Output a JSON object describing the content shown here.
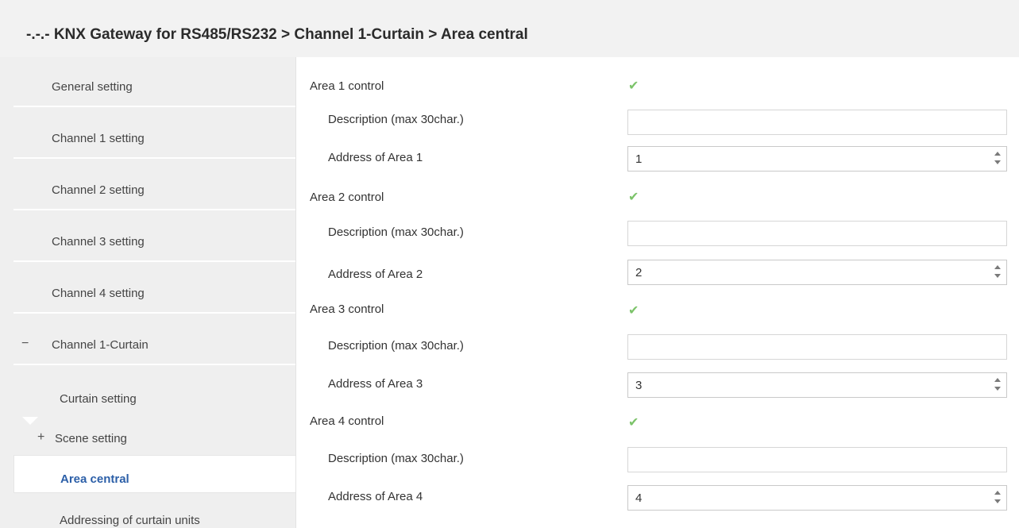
{
  "header": {
    "title": "-.-.- KNX Gateway for RS485/RS232 > Channel 1-Curtain > Area central"
  },
  "sidebar": {
    "items": [
      {
        "label": "General setting"
      },
      {
        "label": "Channel 1 setting"
      },
      {
        "label": "Channel 2 setting"
      },
      {
        "label": "Channel 3 setting"
      },
      {
        "label": "Channel 4 setting"
      },
      {
        "label": "Channel 1-Curtain",
        "sign": "−"
      },
      {
        "label": "Curtain setting"
      },
      {
        "label": "Scene setting",
        "sign": "+"
      },
      {
        "label": "Area central",
        "active": true
      },
      {
        "label": "Addressing of curtain units"
      }
    ]
  },
  "main": {
    "areas": [
      {
        "control_label": "Area 1 control",
        "description_label": "Description (max 30char.)",
        "description_value": "",
        "address_label": "Address of Area 1",
        "address_value": "1",
        "checked": true
      },
      {
        "control_label": "Area 2 control",
        "description_label": "Description (max 30char.)",
        "description_value": "",
        "address_label": "Address of Area 2",
        "address_value": "2",
        "checked": true
      },
      {
        "control_label": "Area 3 control",
        "description_label": "Description (max 30char.)",
        "description_value": "",
        "address_label": "Address of Area 3",
        "address_value": "3",
        "checked": true
      },
      {
        "control_label": "Area 4 control",
        "description_label": "Description (max 30char.)",
        "description_value": "",
        "address_label": "Address of Area 4",
        "address_value": "4",
        "checked": true
      }
    ]
  },
  "icons": {
    "check": "checkmark-icon",
    "spinner": "spinner-arrows-icon",
    "collapse": "minus-icon",
    "expand": "plus-icon"
  },
  "colors": {
    "accent": "#2c5fa8",
    "check": "#7cc36a",
    "sidebar_bg": "#efefef",
    "header_bg": "#f2f2f2"
  }
}
